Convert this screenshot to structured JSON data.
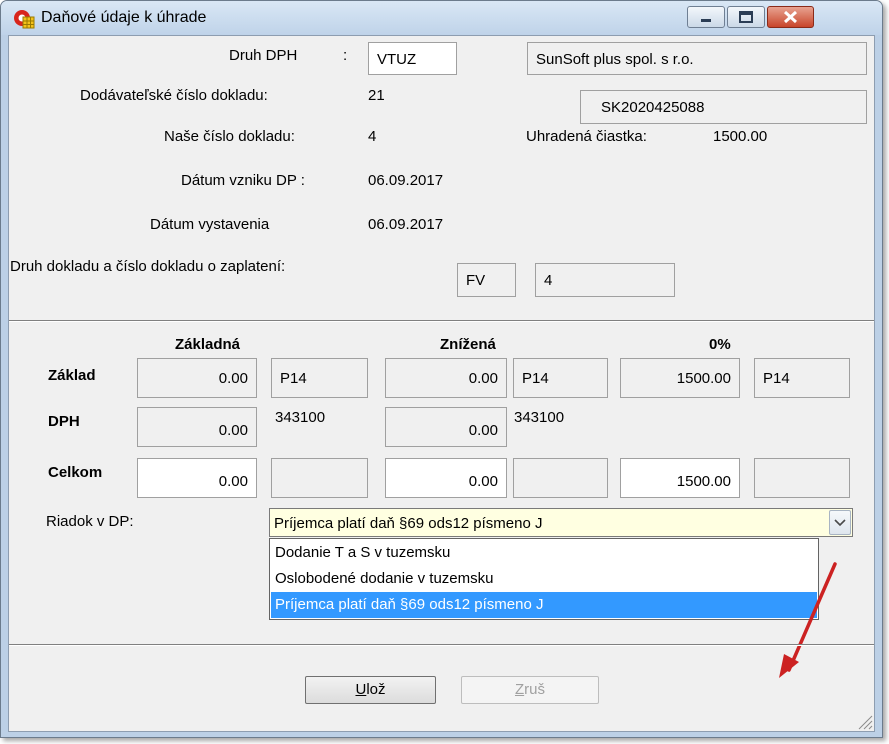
{
  "window": {
    "title": "Daňové údaje k úhrade"
  },
  "header": {
    "druh_dph_label": "Druh DPH",
    "druh_dph_colon": ":",
    "druh_dph_value": "VTUZ",
    "company_name": "SunSoft plus spol. s r.o.",
    "dodavatelske_label": "Dodávateľské číslo dokladu:",
    "dodavatelske_value": "21",
    "ic_dph": "SK2020425088",
    "nase_label": "Naše číslo dokladu:",
    "nase_value": "4",
    "uhradena_label": "Uhradená čiastka:",
    "uhradena_value": "1500.00",
    "datum_vzniku_label": "Dátum vzniku DP :",
    "datum_vzniku_value": "06.09.2017",
    "datum_vystavenia_label": "Dátum  vystavenia",
    "datum_vystavenia_value": "06.09.2017",
    "druh_dokladu_label": "Druh dokladu a číslo dokladu o  zaplatení:",
    "druh_dokladu_type": "FV",
    "druh_dokladu_number": "4"
  },
  "table": {
    "col_zakladna": "Základná",
    "col_znizena": "Znížená",
    "col_zero": "0%",
    "row_zaklad": "Základ",
    "row_dph": "DPH",
    "row_celkom": "Celkom",
    "zaklad": {
      "zakladna": "0.00",
      "zakladna_code": "P14",
      "znizena": "0.00",
      "znizena_code": "P14",
      "zero": "1500.00",
      "zero_code": "P14"
    },
    "dph": {
      "zakladna": "0.00",
      "zakladna_acct": "343100",
      "znizena": "0.00",
      "znizena_acct": "343100"
    },
    "celkom": {
      "zakladna": "0.00",
      "zakladna_extra": "",
      "znizena": "0.00",
      "znizena_extra": "",
      "zero": "1500.00",
      "zero_extra": ""
    }
  },
  "riadok": {
    "label": "Riadok v DP:",
    "selected": "Príjemca platí daň §69 ods12 písmeno J",
    "options": [
      "Dodanie T a S v tuzemsku",
      "Oslobodené dodanie v tuzemsku",
      "Príjemca platí daň §69 ods12 písmeno J"
    ]
  },
  "buttons": {
    "save_underline": "U",
    "save_rest": "lož",
    "cancel_underline": "Z",
    "cancel_rest": "ruš"
  },
  "colors": {
    "selection": "#3399ff",
    "combo_bg": "#ffffe1",
    "annotation_arrow": "#cc2222"
  }
}
